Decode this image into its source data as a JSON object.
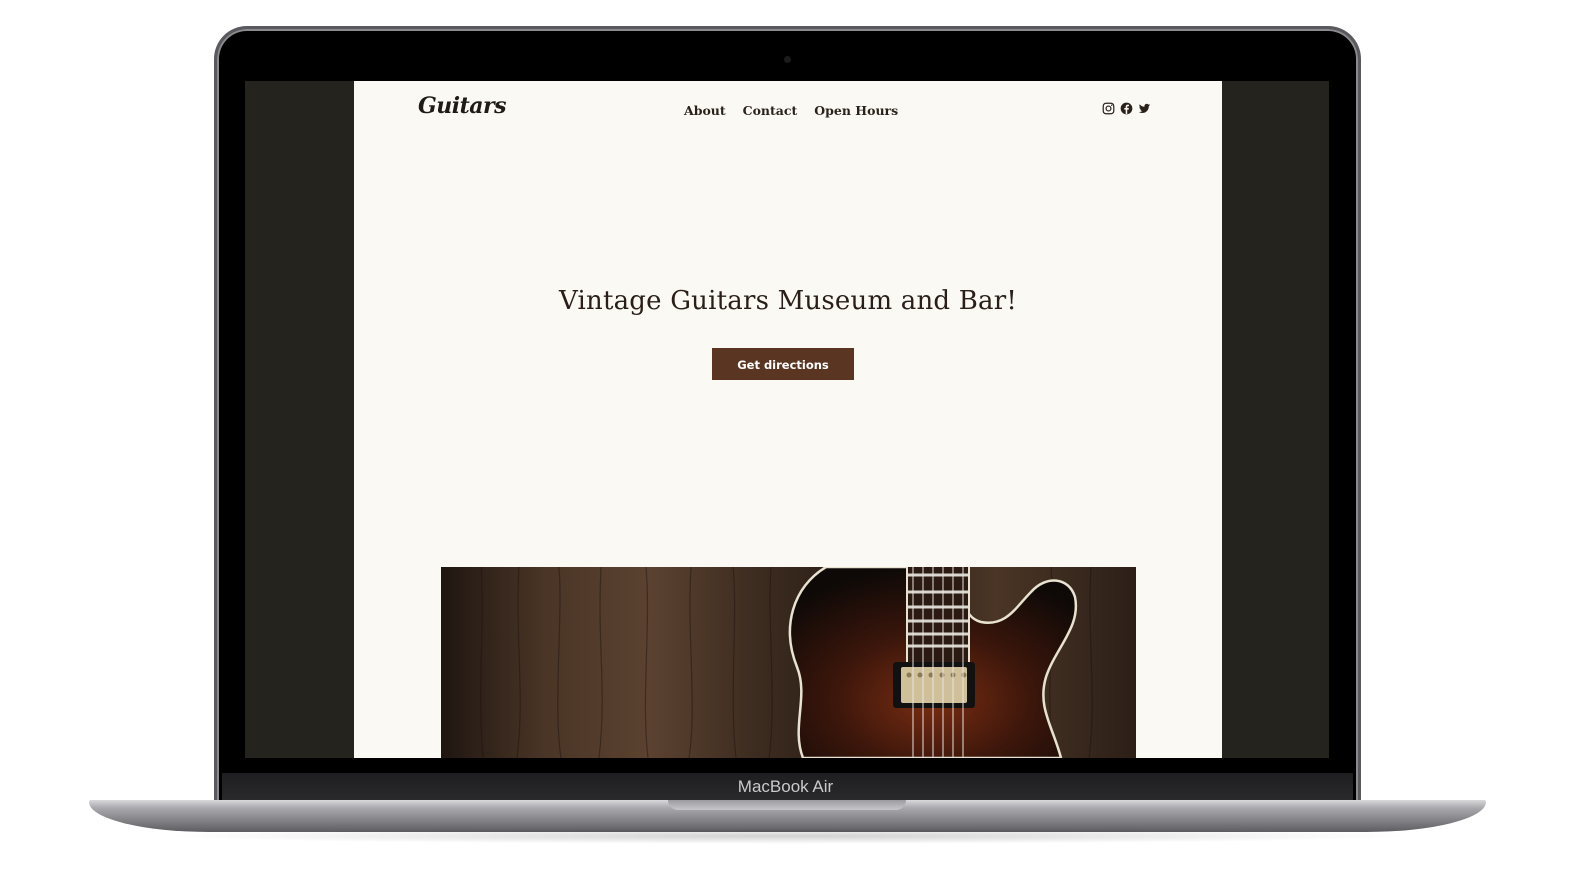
{
  "device": {
    "model_label": "MacBook Air"
  },
  "site": {
    "logo": "Guitars",
    "nav": [
      {
        "label": "About"
      },
      {
        "label": "Contact"
      },
      {
        "label": "Open Hours"
      }
    ],
    "social_icons": [
      "instagram-icon",
      "facebook-icon",
      "twitter-icon"
    ],
    "hero": {
      "title": "Vintage Guitars Museum and Bar!",
      "cta_label": "Get directions"
    },
    "colors": {
      "page_background": "#fbf9f4",
      "screen_background": "#24231e",
      "cta_background": "#5a3522",
      "text": "#2a1f18"
    }
  }
}
